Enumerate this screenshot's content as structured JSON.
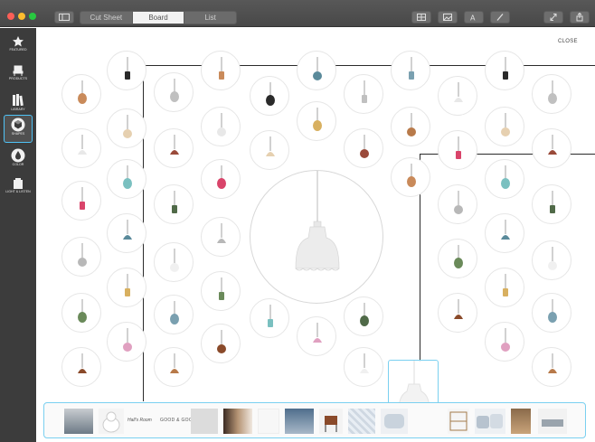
{
  "window": {
    "tabs": [
      {
        "label": "Cut Sheet",
        "active": false
      },
      {
        "label": "Board",
        "active": true
      },
      {
        "label": "List",
        "active": false
      }
    ]
  },
  "sidebar": {
    "items": [
      {
        "label": "FEATURED",
        "icon": "star-icon"
      },
      {
        "label": "PRODUCTS",
        "icon": "chair-icon"
      },
      {
        "label": "LIBRARY",
        "icon": "books-icon"
      },
      {
        "label": "SHAPES",
        "icon": "cube-icon",
        "active": true
      },
      {
        "label": "COLOR",
        "icon": "drop-icon"
      },
      {
        "label": "LIGHT & LISTEN",
        "icon": "fixture-icon"
      }
    ]
  },
  "board": {
    "close_label": "CLOSE"
  },
  "tray": {
    "caption_1": "Hall's Room",
    "caption_2": "GOOD & GOOD"
  },
  "colors": {
    "accent": "#4fc3f7",
    "toolbar": "#4e4e4e",
    "sidebar": "#3c3c3c"
  }
}
